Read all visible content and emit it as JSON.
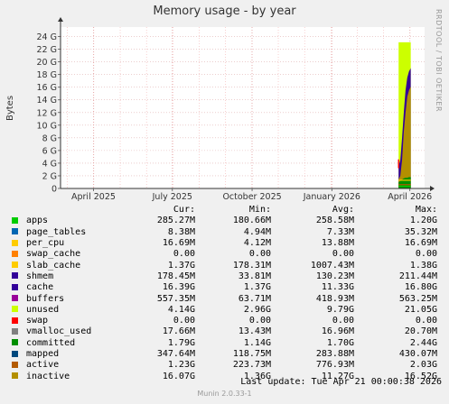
{
  "title": "Memory usage - by year",
  "side_label": "RRDTOOL / TOBI OETIKER",
  "footer": "Munin 2.0.33-1",
  "last_update": "Last update:  Tue Apr 21 00:00:38 2026",
  "legend_headers": [
    "Cur:",
    "Min:",
    "Avg:",
    "Max:"
  ],
  "legend": [
    {
      "name": "apps",
      "color": "#00cc00",
      "cur": "285.27M",
      "min": "180.66M",
      "avg": "258.58M",
      "max": "1.20G"
    },
    {
      "name": "page_tables",
      "color": "#0066b3",
      "cur": "8.38M",
      "min": "4.94M",
      "avg": "7.33M",
      "max": "35.32M"
    },
    {
      "name": "per_cpu",
      "color": "#ffcc00",
      "cur": "16.69M",
      "min": "4.12M",
      "avg": "13.88M",
      "max": "16.69M"
    },
    {
      "name": "swap_cache",
      "color": "#ff8000",
      "cur": "0.00",
      "min": "0.00",
      "avg": "0.00",
      "max": "0.00"
    },
    {
      "name": "slab_cache",
      "color": "#ffcc00",
      "cur": "1.37G",
      "min": "178.31M",
      "avg": "1007.43M",
      "max": "1.38G"
    },
    {
      "name": "shmem",
      "color": "#330099",
      "cur": "178.45M",
      "min": "33.81M",
      "avg": "130.23M",
      "max": "211.44M"
    },
    {
      "name": "cache",
      "color": "#330099",
      "cur": "16.39G",
      "min": "1.37G",
      "avg": "11.33G",
      "max": "16.80G"
    },
    {
      "name": "buffers",
      "color": "#990099",
      "cur": "557.35M",
      "min": "63.71M",
      "avg": "418.93M",
      "max": "563.25M"
    },
    {
      "name": "unused",
      "color": "#ccff00",
      "cur": "4.14G",
      "min": "2.96G",
      "avg": "9.79G",
      "max": "21.05G"
    },
    {
      "name": "swap",
      "color": "#ff0000",
      "cur": "0.00",
      "min": "0.00",
      "avg": "0.00",
      "max": "0.00"
    },
    {
      "name": "vmalloc_used",
      "color": "#808080",
      "cur": "17.66M",
      "min": "13.43M",
      "avg": "16.96M",
      "max": "20.70M"
    },
    {
      "name": "committed",
      "color": "#008f00",
      "cur": "1.79G",
      "min": "1.14G",
      "avg": "1.70G",
      "max": "2.44G"
    },
    {
      "name": "mapped",
      "color": "#00487d",
      "cur": "347.64M",
      "min": "118.75M",
      "avg": "283.88M",
      "max": "430.07M"
    },
    {
      "name": "active",
      "color": "#b35a00",
      "cur": "1.23G",
      "min": "223.73M",
      "avg": "776.93M",
      "max": "2.03G"
    },
    {
      "name": "inactive",
      "color": "#b38f00",
      "cur": "16.07G",
      "min": "1.36G",
      "avg": "11.27G",
      "max": "16.52G"
    }
  ],
  "chart_data": {
    "type": "area",
    "ylabel": "Bytes",
    "yticks": [
      "0",
      "2 G",
      "4 G",
      "6 G",
      "8 G",
      "10 G",
      "12 G",
      "14 G",
      "16 G",
      "18 G",
      "20 G",
      "22 G",
      "24 G"
    ],
    "ylim": [
      0,
      25.5
    ],
    "xticks": [
      {
        "label": "April 2025",
        "t": 0.0
      },
      {
        "label": "July 2025",
        "t": 91
      },
      {
        "label": "October 2025",
        "t": 183
      },
      {
        "label": "January 2026",
        "t": 275
      },
      {
        "label": "April 2026",
        "t": 365
      }
    ],
    "xlim": [
      -38,
      382
    ],
    "grid": true,
    "series": [
      {
        "name": "committed",
        "x": [
          352,
          354,
          356,
          358,
          360,
          362,
          364,
          366
        ],
        "values": [
          1.0,
          1.2,
          1.4,
          1.6,
          1.7,
          1.7,
          1.8,
          1.8
        ]
      },
      {
        "name": "inactive",
        "x": [
          352,
          354,
          356,
          358,
          360,
          362,
          364,
          366
        ],
        "values": [
          1.4,
          2.0,
          4.5,
          9,
          12,
          14.5,
          15.5,
          16.1
        ]
      },
      {
        "name": "cache",
        "x": [
          352,
          354,
          356,
          358,
          360,
          362,
          364,
          366
        ],
        "values": [
          3.5,
          4.5,
          8,
          12,
          15.5,
          17.5,
          18.5,
          19
        ]
      },
      {
        "name": "unused",
        "x": [
          352,
          354,
          356,
          358,
          360,
          362,
          364,
          366
        ],
        "values": [
          23.1,
          23.1,
          23.1,
          23.1,
          23.1,
          23.1,
          23.1,
          23.1
        ]
      }
    ]
  }
}
